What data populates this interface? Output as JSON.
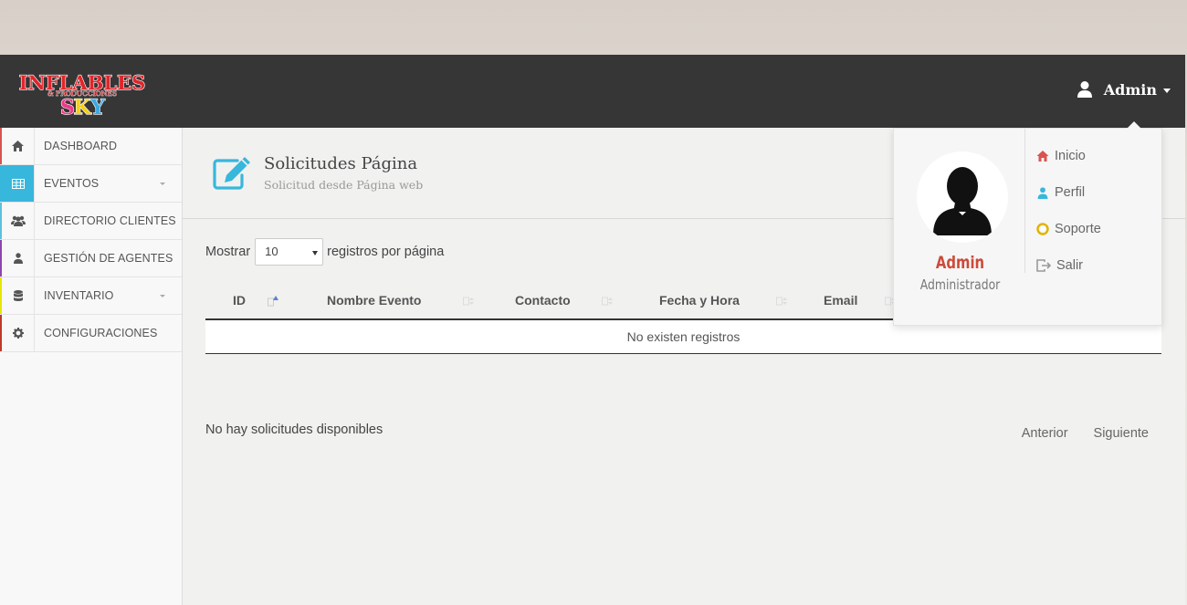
{
  "header": {
    "logo_text": "INFLABLES & PRODUCCIONES SKY",
    "user_name": "Admin"
  },
  "sidebar": {
    "items": [
      {
        "label": "DASHBOARD",
        "icon": "home-icon"
      },
      {
        "label": "EVENTOS",
        "icon": "grid-icon",
        "active": true,
        "has_submenu": true
      },
      {
        "label": "DIRECTORIO CLIENTES",
        "icon": "users-icon"
      },
      {
        "label": "GESTIÓN DE AGENTES",
        "icon": "user-icon"
      },
      {
        "label": "INVENTARIO",
        "icon": "database-icon",
        "has_submenu": true
      },
      {
        "label": "CONFIGURACIONES",
        "icon": "gear-icon"
      }
    ]
  },
  "page": {
    "title": "Solicitudes Página",
    "subtitle": "Solicitud desde Página web",
    "icon": "edit-icon"
  },
  "table_controls": {
    "show_label": "Mostrar",
    "page_size": "10",
    "per_page_label": "registros por página"
  },
  "table": {
    "columns": [
      "ID",
      "Nombre Evento",
      "Contacto",
      "Fecha y Hora",
      "Email"
    ],
    "empty_message": "No existen registros"
  },
  "footer": {
    "info": "No hay solicitudes disponibles",
    "prev": "Anterior",
    "next": "Siguiente"
  },
  "user_dropdown": {
    "name": "Admin",
    "role": "Administrador",
    "items": [
      {
        "label": "Inicio",
        "icon": "home-icon",
        "color": "#d9534f"
      },
      {
        "label": "Perfil",
        "icon": "user-icon",
        "color": "#38b7dc"
      },
      {
        "label": "Soporte",
        "icon": "lifebuoy-icon",
        "color": "#e0b400"
      },
      {
        "label": "Salir",
        "icon": "sign-out-icon",
        "color": "#999999"
      }
    ]
  },
  "colors": {
    "topbar": "#363636",
    "accent": "#38b7dc",
    "admin_name": "#cb4b3a"
  }
}
